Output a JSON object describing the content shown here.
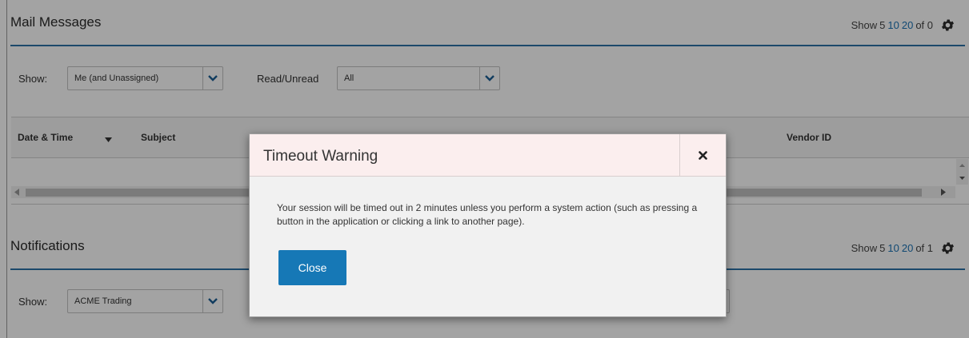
{
  "mail": {
    "title": "Mail Messages",
    "pager": {
      "show": "Show",
      "opt1": "5",
      "opt2": "10",
      "opt3": "20",
      "of": "of 0"
    },
    "show_label": "Show:",
    "show_value": "Me (and Unassigned)",
    "read_label": "Read/Unread",
    "read_value": "All",
    "columns": [
      "Date & Time",
      "Subject",
      "Vendor ID"
    ]
  },
  "notifications": {
    "title": "Notifications",
    "pager": {
      "show": "Show",
      "opt1": "5",
      "opt2": "10",
      "opt3": "20",
      "of": "of 1"
    },
    "show_label": "Show:",
    "show_value": "ACME Trading"
  },
  "modal": {
    "title": "Timeout Warning",
    "message": "Your session will be timed out in 2 minutes unless you perform a system action (such as pressing a button in the application or clicking a link to another page).",
    "close_label": "Close"
  },
  "colors": {
    "accent": "#1678b6",
    "rule": "#2c72a8",
    "modal_header": "#fbeeee",
    "link": "#1b73b5"
  }
}
